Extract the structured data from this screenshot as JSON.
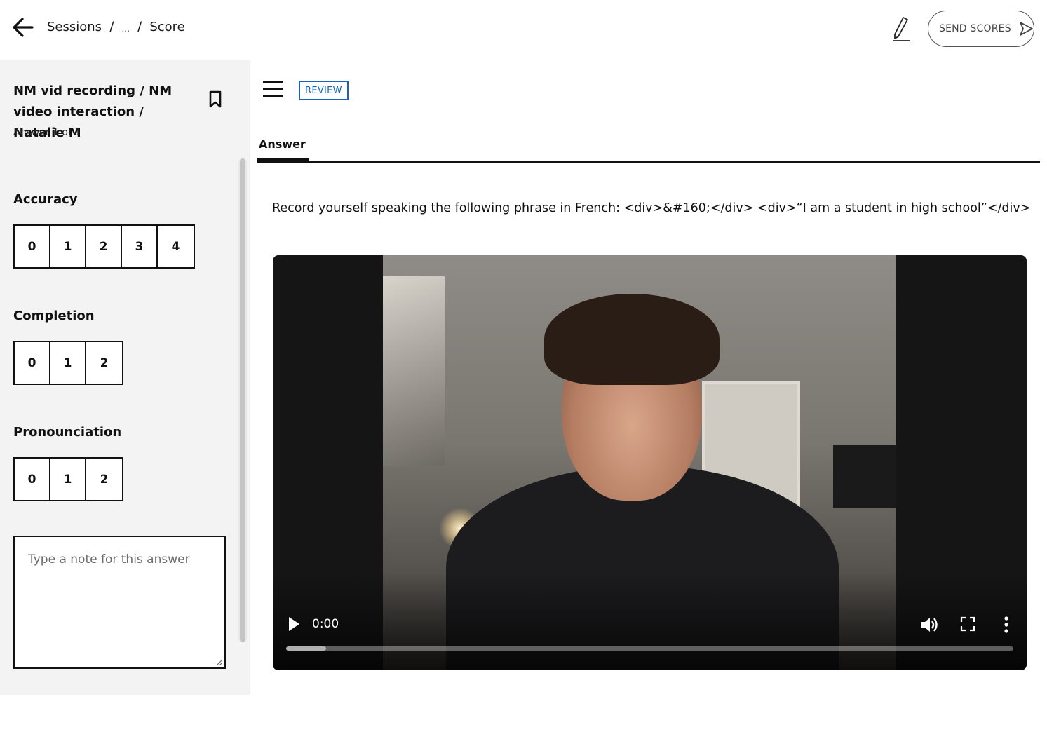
{
  "header": {
    "breadcrumb": {
      "sessions": "Sessions",
      "ellipsis": "...",
      "current": "Score"
    },
    "send_scores": "SEND SCORES"
  },
  "sidebar": {
    "title": "NM vid recording / NM video interaction / Natalie M",
    "subtitle": "Answer 1 of 1",
    "criteria": [
      {
        "label": "Accuracy",
        "scores": [
          "0",
          "1",
          "2",
          "3",
          "4"
        ]
      },
      {
        "label": "Completion",
        "scores": [
          "0",
          "1",
          "2"
        ]
      },
      {
        "label": "Pronounciation",
        "scores": [
          "0",
          "1",
          "2"
        ]
      }
    ],
    "note_placeholder": "Type a note for this answer"
  },
  "main": {
    "badge": "REVIEW",
    "tab": "Answer",
    "prompt": "Record yourself speaking the following phrase in French: <div>&#160;</div> <div>“I am a student in high school”</div>",
    "video": {
      "time": "0:00",
      "progress": 0.055
    }
  },
  "icons": {
    "back": "arrow-left-icon",
    "pen": "pen-icon",
    "send": "send-arrow-icon",
    "bookmark": "bookmark-icon",
    "menu": "hamburger-menu-icon",
    "play": "play-icon",
    "volume": "volume-icon",
    "fullscreen": "fullscreen-icon",
    "more": "more-vertical-icon"
  },
  "colors": {
    "accent": "#1565c0",
    "sidebar_bg": "#f3f3f3"
  }
}
